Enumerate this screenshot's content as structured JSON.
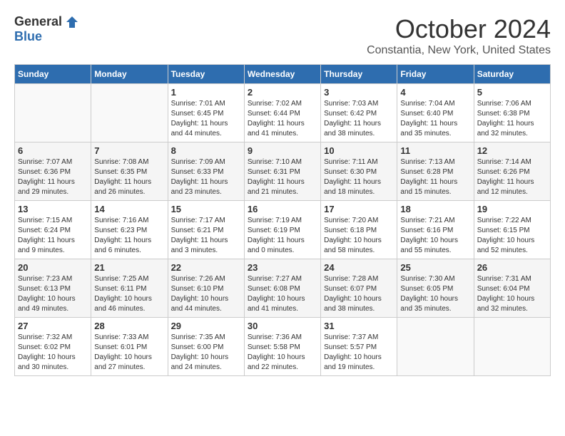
{
  "logo": {
    "general": "General",
    "blue": "Blue"
  },
  "header": {
    "month": "October 2024",
    "location": "Constantia, New York, United States"
  },
  "weekdays": [
    "Sunday",
    "Monday",
    "Tuesday",
    "Wednesday",
    "Thursday",
    "Friday",
    "Saturday"
  ],
  "weeks": [
    [
      {
        "day": "",
        "detail": ""
      },
      {
        "day": "",
        "detail": ""
      },
      {
        "day": "1",
        "detail": "Sunrise: 7:01 AM\nSunset: 6:45 PM\nDaylight: 11 hours and 44 minutes."
      },
      {
        "day": "2",
        "detail": "Sunrise: 7:02 AM\nSunset: 6:44 PM\nDaylight: 11 hours and 41 minutes."
      },
      {
        "day": "3",
        "detail": "Sunrise: 7:03 AM\nSunset: 6:42 PM\nDaylight: 11 hours and 38 minutes."
      },
      {
        "day": "4",
        "detail": "Sunrise: 7:04 AM\nSunset: 6:40 PM\nDaylight: 11 hours and 35 minutes."
      },
      {
        "day": "5",
        "detail": "Sunrise: 7:06 AM\nSunset: 6:38 PM\nDaylight: 11 hours and 32 minutes."
      }
    ],
    [
      {
        "day": "6",
        "detail": "Sunrise: 7:07 AM\nSunset: 6:36 PM\nDaylight: 11 hours and 29 minutes."
      },
      {
        "day": "7",
        "detail": "Sunrise: 7:08 AM\nSunset: 6:35 PM\nDaylight: 11 hours and 26 minutes."
      },
      {
        "day": "8",
        "detail": "Sunrise: 7:09 AM\nSunset: 6:33 PM\nDaylight: 11 hours and 23 minutes."
      },
      {
        "day": "9",
        "detail": "Sunrise: 7:10 AM\nSunset: 6:31 PM\nDaylight: 11 hours and 21 minutes."
      },
      {
        "day": "10",
        "detail": "Sunrise: 7:11 AM\nSunset: 6:30 PM\nDaylight: 11 hours and 18 minutes."
      },
      {
        "day": "11",
        "detail": "Sunrise: 7:13 AM\nSunset: 6:28 PM\nDaylight: 11 hours and 15 minutes."
      },
      {
        "day": "12",
        "detail": "Sunrise: 7:14 AM\nSunset: 6:26 PM\nDaylight: 11 hours and 12 minutes."
      }
    ],
    [
      {
        "day": "13",
        "detail": "Sunrise: 7:15 AM\nSunset: 6:24 PM\nDaylight: 11 hours and 9 minutes."
      },
      {
        "day": "14",
        "detail": "Sunrise: 7:16 AM\nSunset: 6:23 PM\nDaylight: 11 hours and 6 minutes."
      },
      {
        "day": "15",
        "detail": "Sunrise: 7:17 AM\nSunset: 6:21 PM\nDaylight: 11 hours and 3 minutes."
      },
      {
        "day": "16",
        "detail": "Sunrise: 7:19 AM\nSunset: 6:19 PM\nDaylight: 11 hours and 0 minutes."
      },
      {
        "day": "17",
        "detail": "Sunrise: 7:20 AM\nSunset: 6:18 PM\nDaylight: 10 hours and 58 minutes."
      },
      {
        "day": "18",
        "detail": "Sunrise: 7:21 AM\nSunset: 6:16 PM\nDaylight: 10 hours and 55 minutes."
      },
      {
        "day": "19",
        "detail": "Sunrise: 7:22 AM\nSunset: 6:15 PM\nDaylight: 10 hours and 52 minutes."
      }
    ],
    [
      {
        "day": "20",
        "detail": "Sunrise: 7:23 AM\nSunset: 6:13 PM\nDaylight: 10 hours and 49 minutes."
      },
      {
        "day": "21",
        "detail": "Sunrise: 7:25 AM\nSunset: 6:11 PM\nDaylight: 10 hours and 46 minutes."
      },
      {
        "day": "22",
        "detail": "Sunrise: 7:26 AM\nSunset: 6:10 PM\nDaylight: 10 hours and 44 minutes."
      },
      {
        "day": "23",
        "detail": "Sunrise: 7:27 AM\nSunset: 6:08 PM\nDaylight: 10 hours and 41 minutes."
      },
      {
        "day": "24",
        "detail": "Sunrise: 7:28 AM\nSunset: 6:07 PM\nDaylight: 10 hours and 38 minutes."
      },
      {
        "day": "25",
        "detail": "Sunrise: 7:30 AM\nSunset: 6:05 PM\nDaylight: 10 hours and 35 minutes."
      },
      {
        "day": "26",
        "detail": "Sunrise: 7:31 AM\nSunset: 6:04 PM\nDaylight: 10 hours and 32 minutes."
      }
    ],
    [
      {
        "day": "27",
        "detail": "Sunrise: 7:32 AM\nSunset: 6:02 PM\nDaylight: 10 hours and 30 minutes."
      },
      {
        "day": "28",
        "detail": "Sunrise: 7:33 AM\nSunset: 6:01 PM\nDaylight: 10 hours and 27 minutes."
      },
      {
        "day": "29",
        "detail": "Sunrise: 7:35 AM\nSunset: 6:00 PM\nDaylight: 10 hours and 24 minutes."
      },
      {
        "day": "30",
        "detail": "Sunrise: 7:36 AM\nSunset: 5:58 PM\nDaylight: 10 hours and 22 minutes."
      },
      {
        "day": "31",
        "detail": "Sunrise: 7:37 AM\nSunset: 5:57 PM\nDaylight: 10 hours and 19 minutes."
      },
      {
        "day": "",
        "detail": ""
      },
      {
        "day": "",
        "detail": ""
      }
    ]
  ]
}
